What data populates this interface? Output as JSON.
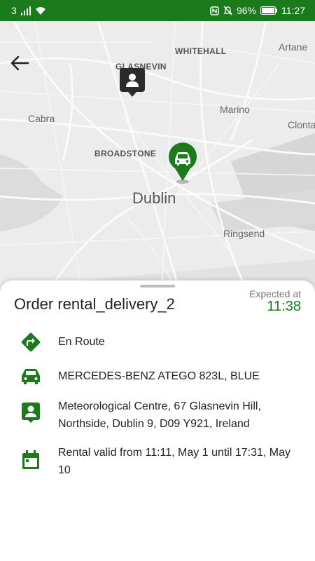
{
  "status_bar": {
    "carrier": "3",
    "battery": "96%",
    "time": "11:27"
  },
  "map": {
    "labels": {
      "whitehall": "WHITEHALL",
      "artane": "Artane",
      "glasnevin": "GLASNEVIN",
      "cabra": "Cabra",
      "marino": "Marino",
      "clontarf": "Clonta",
      "broadstone": "BROADSTONE",
      "dublin": "Dublin",
      "ringsend": "Ringsend"
    }
  },
  "order": {
    "title": "Order rental_delivery_2",
    "expected_label": "Expected at",
    "expected_time": "11:38"
  },
  "details": {
    "status": "En Route",
    "vehicle": "MERCEDES-BENZ ATEGO 823L, BLUE",
    "address": "Meteorological Centre, 67 Glasnevin Hill, Northside, Dublin 9, D09 Y921, Ireland",
    "rental": "Rental valid from 11:11, May 1 until 17:31, May 10"
  },
  "colors": {
    "brand_green": "#1b7a1b"
  }
}
